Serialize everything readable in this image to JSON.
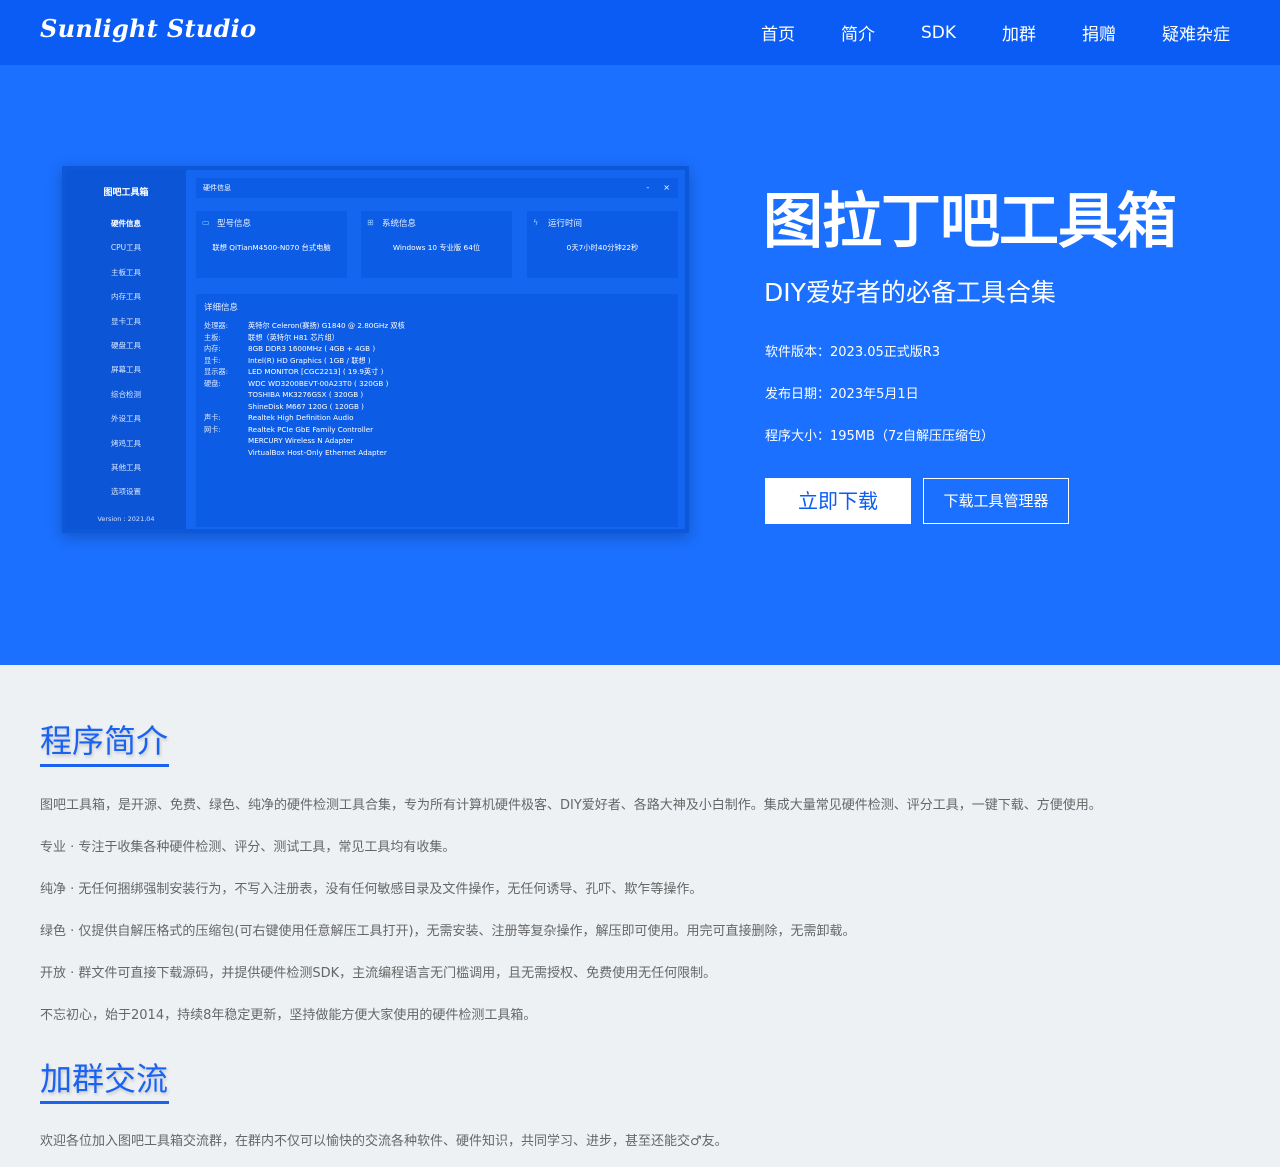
{
  "header": {
    "logo": "Sunlight Studio",
    "nav": [
      "首页",
      "简介",
      "SDK",
      "加群",
      "捐赠",
      "疑难杂症"
    ]
  },
  "app": {
    "title": "图吧工具箱",
    "menu": [
      "硬件信息",
      "CPU工具",
      "主板工具",
      "内存工具",
      "显卡工具",
      "硬盘工具",
      "屏幕工具",
      "综合检测",
      "外设工具",
      "烤鸡工具",
      "其他工具",
      "选项设置"
    ],
    "version": "Version : 2021.04",
    "window_title": "硬件信息",
    "window_controls": [
      "-",
      "×"
    ],
    "cards": [
      {
        "title": "型号信息",
        "value": "联想 QiTianM4500-N070 台式电脑"
      },
      {
        "title": "系统信息",
        "value": "Windows 10 专业版 64位"
      },
      {
        "title": "运行时间",
        "value": "0天7小时40分钟22秒"
      }
    ],
    "detail_title": "详细信息",
    "details": [
      {
        "k": "处理器:",
        "v": "英特尔 Celeron(赛扬) G1840 @ 2.80GHz 双核"
      },
      {
        "k": "主板:",
        "v": "联想（英特尔 H81 芯片组）"
      },
      {
        "k": "内存:",
        "v": "8GB DDR3 1600MHz ( 4GB + 4GB )"
      },
      {
        "k": "显卡:",
        "v": "Intel(R) HD Graphics ( 1GB / 联想 )"
      },
      {
        "k": "显示器:",
        "v": "LED MONITOR [CGC2213] ( 19.9英寸 )"
      },
      {
        "k": "硬盘:",
        "v": "WDC WD3200BEVT-00A23T0 ( 320GB )"
      },
      {
        "k": "",
        "v": "TOSHIBA MK3276GSX ( 320GB )"
      },
      {
        "k": "",
        "v": "ShineDisk M667 120G ( 120GB )"
      },
      {
        "k": "声卡:",
        "v": "Realtek High Definition Audio"
      },
      {
        "k": "网卡:",
        "v": "Realtek PCIe GbE Family Controller"
      },
      {
        "k": "",
        "v": "MERCURY Wireless N Adapter"
      },
      {
        "k": "",
        "v": "VirtualBox Host-Only Ethernet Adapter"
      }
    ]
  },
  "hero": {
    "title": "图拉丁吧工具箱",
    "subtitle": "DIY爱好者的必备工具合集",
    "version": "软件版本：2023.05正式版R3",
    "date": "发布日期：2023年5月1日",
    "size": "程序大小：195MB（7z自解压压缩包）",
    "download": "立即下载",
    "manager": "下载工具管理器"
  },
  "intro": {
    "title": "程序简介",
    "paragraphs": [
      "图吧工具箱，是开源、免费、绿色、纯净的硬件检测工具合集，专为所有计算机硬件极客、DIY爱好者、各路大神及小白制作。集成大量常见硬件检测、评分工具，一键下载、方便使用。",
      "专业 · 专注于收集各种硬件检测、评分、测试工具，常见工具均有收集。",
      "纯净 · 无任何捆绑强制安装行为，不写入注册表，没有任何敏感目录及文件操作，无任何诱导、孔吓、欺乍等操作。",
      "绿色 · 仅提供自解压格式的压缩包(可右键使用任意解压工具打开)，无需安装、注册等复杂操作，解压即可使用。用完可直接删除，无需卸载。",
      "开放 · 群文件可直接下载源码，并提供硬件检测SDK，主流编程语言无门槛调用，且无需授权、免费使用无任何限制。",
      "不忘初心，始于2014，持续8年稳定更新，坚持做能方便大家使用的硬件检测工具箱。"
    ]
  },
  "group": {
    "title": "加群交流",
    "text": "欢迎各位加入图吧工具箱交流群，在群内不仅可以愉快的交流各种软件、硬件知识，共同学习、进步，甚至还能交♂友。"
  }
}
